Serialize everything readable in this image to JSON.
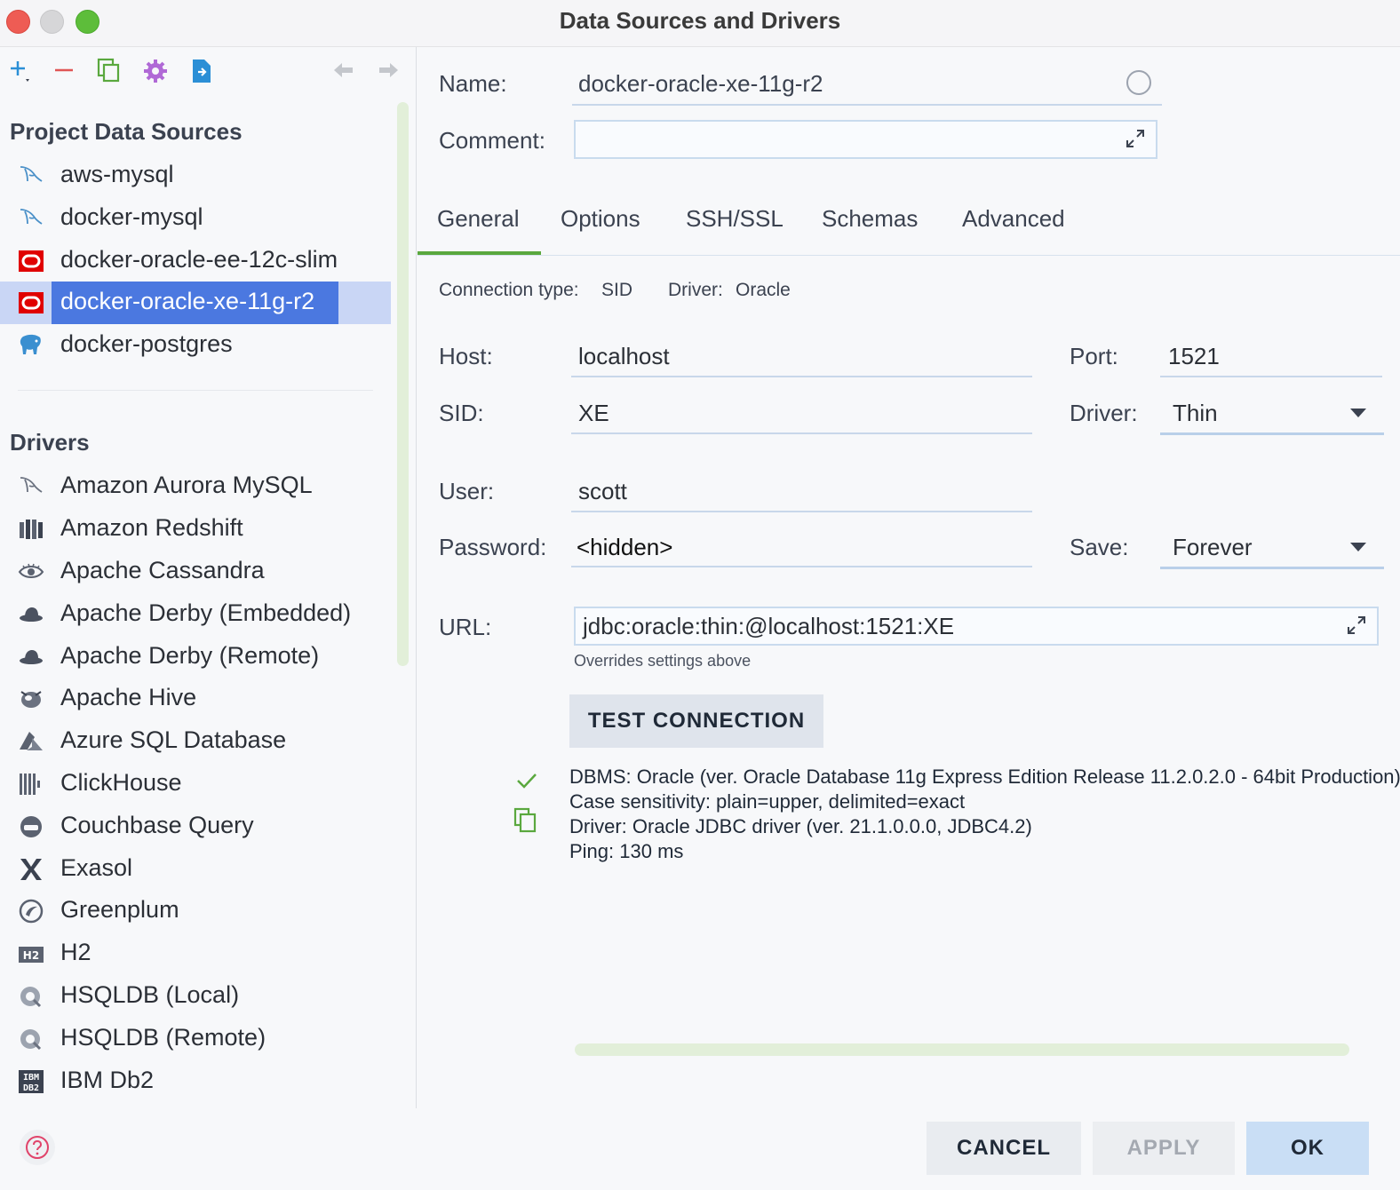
{
  "window": {
    "title": "Data Sources and Drivers"
  },
  "toolbar": {
    "icons": [
      "add-icon",
      "remove-icon",
      "duplicate-icon",
      "settings-icon",
      "import-icon",
      "back-arrow-icon",
      "forward-arrow-icon"
    ]
  },
  "sidebar": {
    "project_title": "Project Data Sources",
    "data_sources": [
      {
        "label": "aws-mysql",
        "icon": "mysql-dolphin-icon"
      },
      {
        "label": "docker-mysql",
        "icon": "mysql-dolphin-icon"
      },
      {
        "label": "docker-oracle-ee-12c-slim",
        "icon": "oracle-icon"
      },
      {
        "label": "docker-oracle-xe-11g-r2",
        "icon": "oracle-icon",
        "selected": true
      },
      {
        "label": "docker-postgres",
        "icon": "postgres-elephant-icon"
      }
    ],
    "drivers_title": "Drivers",
    "drivers": [
      {
        "label": "Amazon Aurora MySQL",
        "icon": "mysql-dolphin-icon"
      },
      {
        "label": "Amazon Redshift",
        "icon": "redshift-icon"
      },
      {
        "label": "Apache Cassandra",
        "icon": "cassandra-eye-icon"
      },
      {
        "label": "Apache Derby (Embedded)",
        "icon": "derby-hat-icon"
      },
      {
        "label": "Apache Derby (Remote)",
        "icon": "derby-hat-icon"
      },
      {
        "label": "Apache Hive",
        "icon": "hive-bee-icon"
      },
      {
        "label": "Azure SQL Database",
        "icon": "azure-icon"
      },
      {
        "label": "ClickHouse",
        "icon": "clickhouse-bars-icon"
      },
      {
        "label": "Couchbase Query",
        "icon": "couchbase-icon"
      },
      {
        "label": "Exasol",
        "icon": "exasol-x-icon"
      },
      {
        "label": "Greenplum",
        "icon": "greenplum-icon"
      },
      {
        "label": "H2",
        "icon": "h2-icon"
      },
      {
        "label": "HSQLDB (Local)",
        "icon": "hsqldb-icon"
      },
      {
        "label": "HSQLDB (Remote)",
        "icon": "hsqldb-icon"
      },
      {
        "label": "IBM Db2",
        "icon": "ibm-db2-icon"
      }
    ]
  },
  "form": {
    "name_label": "Name:",
    "name_value": "docker-oracle-xe-11g-r2",
    "comment_label": "Comment:",
    "comment_value": "",
    "tabs": [
      "General",
      "Options",
      "SSH/SSL",
      "Schemas",
      "Advanced"
    ],
    "active_tab": "General",
    "connection_type_label": "Connection type:",
    "connection_type_value": "SID",
    "driver_info_label": "Driver:",
    "driver_info_value": "Oracle",
    "host_label": "Host:",
    "host_value": "localhost",
    "port_label": "Port:",
    "port_value": "1521",
    "sid_label": "SID:",
    "sid_value": "XE",
    "driver_label": "Driver:",
    "driver_value": "Thin",
    "user_label": "User:",
    "user_value": "scott",
    "password_label": "Password:",
    "password_value": "<hidden>",
    "save_label": "Save:",
    "save_value": "Forever",
    "url_label": "URL:",
    "url_value": "jdbc:oracle:thin:@localhost:1521:XE",
    "url_hint": "Overrides settings above",
    "test_button": "TEST CONNECTION",
    "result_lines": [
      "DBMS: Oracle (ver. Oracle Database 11g Express Edition Release 11.2.0.2.0 - 64bit Production)",
      "Case sensitivity: plain=upper, delimited=exact",
      "Driver: Oracle JDBC driver (ver. 21.1.0.0.0, JDBC4.2)",
      "Ping: 130 ms"
    ]
  },
  "footer": {
    "cancel": "CANCEL",
    "apply": "APPLY",
    "ok": "OK"
  },
  "colors": {
    "accent_green": "#5aa83e",
    "selection_blue": "#4b78e0",
    "oracle_red": "#e00000"
  }
}
